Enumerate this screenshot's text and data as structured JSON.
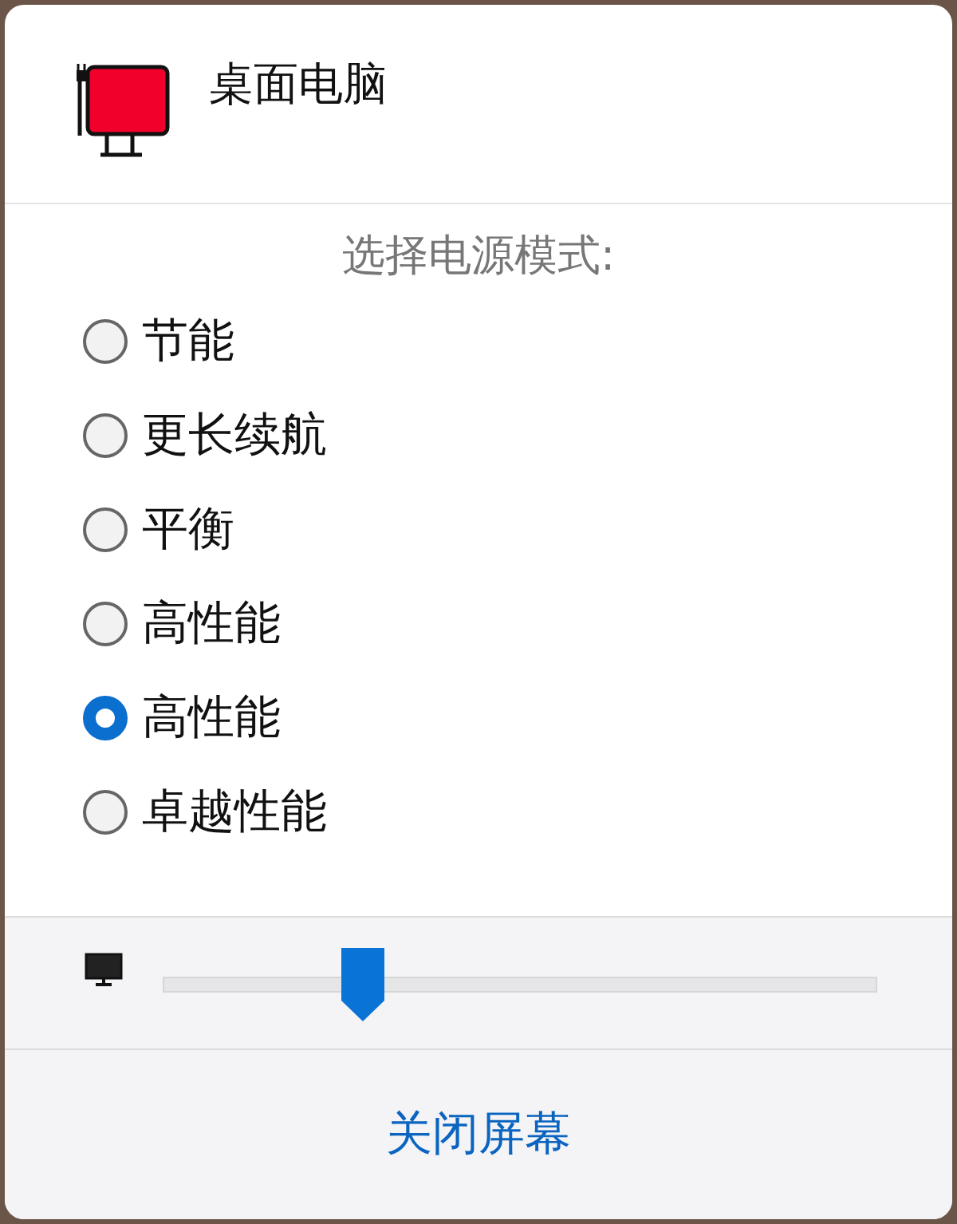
{
  "device": {
    "title": "桌面电脑"
  },
  "power_mode": {
    "prompt": "选择电源模式:",
    "options": [
      {
        "label": "节能",
        "selected": false
      },
      {
        "label": "更长续航",
        "selected": false
      },
      {
        "label": "平衡",
        "selected": false
      },
      {
        "label": "高性能",
        "selected": false
      },
      {
        "label": "高性能",
        "selected": true
      },
      {
        "label": "卓越性能",
        "selected": false
      }
    ]
  },
  "brightness": {
    "level": 0.28
  },
  "footer": {
    "button": "关闭屏幕"
  }
}
